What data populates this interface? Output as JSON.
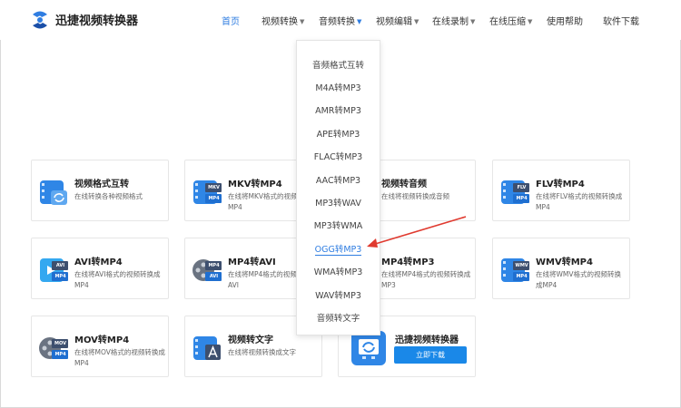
{
  "header": {
    "brand": "迅捷视频转换器",
    "nav": [
      {
        "label": "首页"
      },
      {
        "label": "视频转换"
      },
      {
        "label": "音频转换"
      },
      {
        "label": "视频编辑"
      },
      {
        "label": "在线录制"
      },
      {
        "label": "在线压缩"
      },
      {
        "label": "使用帮助"
      },
      {
        "label": "软件下载"
      }
    ]
  },
  "cards": [
    {
      "title": "视频格式互转",
      "desc": "在线转换各种视频格式",
      "icon": "video-convert-icon"
    },
    {
      "title": "MKV转MP4",
      "desc": "在线将MKV格式的视频转换成MP4",
      "icon": "mkv-mp4-icon",
      "badge_top": "MKV",
      "badge_bottom": "MP4"
    },
    {
      "title": "视频转音频",
      "desc": "在线将视频转换成音频",
      "icon": "video-audio-icon"
    },
    {
      "title": "FLV转MP4",
      "desc": "在线将FLV格式的视频转换成MP4",
      "icon": "flv-mp4-icon",
      "badge_top": "FLV",
      "badge_bottom": "MP4"
    },
    {
      "title": "AVI转MP4",
      "desc": "在线将AVI格式的视频转换成MP4",
      "icon": "avi-mp4-icon",
      "badge_top": "AVI",
      "badge_bottom": "MP4"
    },
    {
      "title": "MP4转AVI",
      "desc": "在线将MP4格式的视频转换成AVI",
      "icon": "mp4-avi-icon",
      "badge_top": "MP4",
      "badge_bottom": "AVI"
    },
    {
      "title": "MP4转MP3",
      "desc": "在线将MP4格式的视频转换成MP3",
      "icon": "mp4-mp3-icon"
    },
    {
      "title": "WMV转MP4",
      "desc": "在线将WMV格式的视频转换成MP4",
      "icon": "wmv-mp4-icon",
      "badge_top": "WMV",
      "badge_bottom": "MP4"
    },
    {
      "title": "MOV转MP4",
      "desc": "在线将MOV格式的视频转换成MP4",
      "icon": "mov-mp4-icon",
      "badge_top": "MOV",
      "badge_bottom": "MP4"
    },
    {
      "title": "视频转文字",
      "desc": "在线将视频转换成文字",
      "icon": "video-text-icon"
    }
  ],
  "download_card": {
    "title": "迅捷视频转换器",
    "button": "立即下载"
  },
  "dropdown": {
    "items": [
      "音频格式互转",
      "M4A转MP3",
      "AMR转MP3",
      "APE转MP3",
      "FLAC转MP3",
      "AAC转MP3",
      "MP3转WAV",
      "MP3转WMA",
      "OGG转MP3",
      "WMA转MP3",
      "WAV转MP3",
      "音频转文字"
    ],
    "highlighted": "OGG转MP3"
  },
  "colors": {
    "accent": "#2f7de1",
    "button": "#1a88e8",
    "icon_blue": "#2f86e6",
    "icon_gray": "#6a7381",
    "annotation_arrow": "#e03a2f"
  }
}
